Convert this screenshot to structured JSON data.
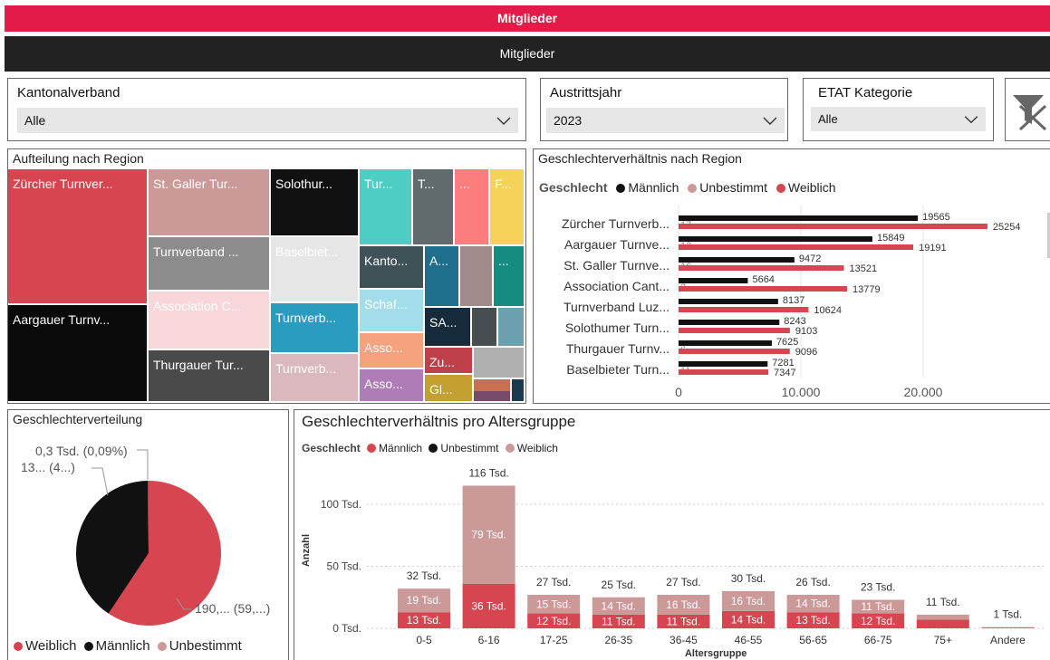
{
  "header": {
    "title": "Mitglieder",
    "subtitle": "Mitglieder"
  },
  "slicers": {
    "kantonalverband": {
      "label": "Kantonalverband",
      "value": "Alle"
    },
    "austrittsjahr": {
      "label": "Austrittsjahr",
      "value": "2023"
    },
    "etat": {
      "label": "ETAT Kategorie",
      "value": "Alle"
    }
  },
  "treemap": {
    "title": "Aufteilung nach Region",
    "cells": [
      {
        "label": "Zürcher Turnver...",
        "color": "#d64550"
      },
      {
        "label": "St. Galler Tur...",
        "color": "#cc9999"
      },
      {
        "label": "Solothur...",
        "color": "#111111"
      },
      {
        "label": "Tur...",
        "color": "#4ecdc4"
      },
      {
        "label": "T...",
        "color": "#5f6b6d"
      },
      {
        "label": "...",
        "color": "#fb7d7d"
      },
      {
        "label": "F...",
        "color": "#f5d35a"
      },
      {
        "label": "Turnverband ...",
        "color": "#8c8c8c"
      },
      {
        "label": "Baselbiet...",
        "color": "#e6e6e6"
      },
      {
        "label": "Kanto...",
        "color": "#3f5257"
      },
      {
        "label": "A...",
        "color": "#1f6e8c"
      },
      {
        "label": "",
        "color": "#a08a8a"
      },
      {
        "label": "...",
        "color": "#168b80"
      },
      {
        "label": "Association C...",
        "color": "#f8d7da"
      },
      {
        "label": "Schaf...",
        "color": "#a3ddea"
      },
      {
        "label": "Aargauer Turnv...",
        "color": "#0a0a0a"
      },
      {
        "label": "Turnverb...",
        "color": "#2a9cc0"
      },
      {
        "label": "SA...",
        "color": "#162b3b"
      },
      {
        "label": "",
        "color": "#464e52"
      },
      {
        "label": "",
        "color": "#6aa0b0"
      },
      {
        "label": "Asso...",
        "color": "#f7a27f"
      },
      {
        "label": "Zu...",
        "color": "#c0404a"
      },
      {
        "label": "",
        "color": "#b0b0b0"
      },
      {
        "label": "Thurgauer Tur...",
        "color": "#4a4a4a"
      },
      {
        "label": "Turnverb...",
        "color": "#dbb8bd"
      },
      {
        "label": "Asso...",
        "color": "#b07cb8"
      },
      {
        "label": "Gl...",
        "color": "#c4a030"
      },
      {
        "label": "",
        "color": "#c97050"
      },
      {
        "label": "",
        "color": "#1a3a50"
      },
      {
        "label": "",
        "color": "#7a4a6a"
      }
    ]
  },
  "region_chart": {
    "title": "Geschlechterverhältnis nach Region",
    "legend_title": "Geschlecht",
    "legend": [
      {
        "name": "Männlich",
        "color": "#111111"
      },
      {
        "name": "Unbestimmt",
        "color": "#cc9999"
      },
      {
        "name": "Weiblich",
        "color": "#d64550"
      }
    ]
  },
  "gender_pie": {
    "title": "Geschlechterverteilung",
    "labels": [
      "0,3 Tsd. (0,09%)",
      "13... (4...)",
      "190,... (59,...)"
    ],
    "legend": [
      {
        "name": "Weiblich",
        "color": "#d64550"
      },
      {
        "name": "Männlich",
        "color": "#111111"
      },
      {
        "name": "Unbestimmt",
        "color": "#cc9999"
      }
    ]
  },
  "age_chart": {
    "title": "Geschlechterverhältnis pro Altersgruppe",
    "legend_title": "Geschlecht",
    "legend": [
      {
        "name": "Männlich",
        "color": "#d64550"
      },
      {
        "name": "Unbestimmt",
        "color": "#111111"
      },
      {
        "name": "Weiblich",
        "color": "#cc9999"
      }
    ]
  },
  "chart_data": [
    {
      "type": "bar",
      "orientation": "horizontal",
      "title": "Geschlechterverhältnis nach Region",
      "categories": [
        "Zürcher Turnverb...",
        "Aargauer Turnve...",
        "St. Galler Turnve...",
        "Association Cant...",
        "Turnverband Luz...",
        "Solothumer Turn...",
        "Thurgauer Turnv...",
        "Baselbieter Turn..."
      ],
      "series": [
        {
          "name": "Männlich",
          "values": [
            19565,
            15849,
            9472,
            5664,
            8137,
            8243,
            7625,
            7281
          ]
        },
        {
          "name": "Unbestimmt",
          "values": [
            17,
            13,
            16,
            2,
            null,
            null,
            6,
            11
          ]
        },
        {
          "name": "Weiblich",
          "values": [
            25254,
            19191,
            13521,
            13779,
            10624,
            9103,
            9096,
            7347
          ]
        }
      ],
      "x_ticks": [
        "0",
        "10.000",
        "20.000"
      ],
      "xlim": [
        0,
        25254
      ]
    },
    {
      "type": "pie",
      "title": "Geschlechterverteilung",
      "slices": [
        {
          "name": "Weiblich",
          "value": 190
        },
        {
          "name": "Männlich",
          "value": 130
        },
        {
          "name": "Unbestimmt",
          "value": 0.3
        }
      ]
    },
    {
      "type": "bar",
      "stacked": true,
      "title": "Geschlechterverhältnis pro Altersgruppe",
      "xlabel": "Altersgruppe",
      "ylabel": "Anzahl",
      "categories": [
        "0-5",
        "6-16",
        "17-25",
        "26-35",
        "36-45",
        "46-55",
        "56-65",
        "66-75",
        "75+",
        "Andere"
      ],
      "series": [
        {
          "name": "Männlich",
          "values": [
            13,
            36,
            12,
            11,
            11,
            14,
            13,
            12,
            7,
            0.4
          ],
          "labels": [
            "13 Tsd.",
            "36 Tsd.",
            "12 Tsd.",
            "11 Tsd.",
            "11 Tsd.",
            "14 Tsd.",
            "13 Tsd.",
            "12 Tsd.",
            "",
            ""
          ]
        },
        {
          "name": "Weiblich",
          "values": [
            19,
            79,
            15,
            14,
            16,
            16,
            14,
            11,
            4,
            0.6
          ],
          "labels": [
            "19 Tsd.",
            "79 Tsd.",
            "15 Tsd.",
            "14 Tsd.",
            "16 Tsd.",
            "16 Tsd.",
            "14 Tsd.",
            "11 Tsd.",
            "",
            ""
          ]
        }
      ],
      "totals": [
        "32 Tsd.",
        "116 Tsd.",
        "27 Tsd.",
        "25 Tsd.",
        "27 Tsd.",
        "30 Tsd.",
        "26 Tsd.",
        "23 Tsd.",
        "11 Tsd.",
        "1 Tsd."
      ],
      "y_ticks": [
        {
          "v": 0,
          "label": "0 Tsd."
        },
        {
          "v": 50,
          "label": "50 Tsd."
        },
        {
          "v": 100,
          "label": "100 Tsd."
        }
      ],
      "ylim": [
        0,
        116
      ]
    }
  ]
}
